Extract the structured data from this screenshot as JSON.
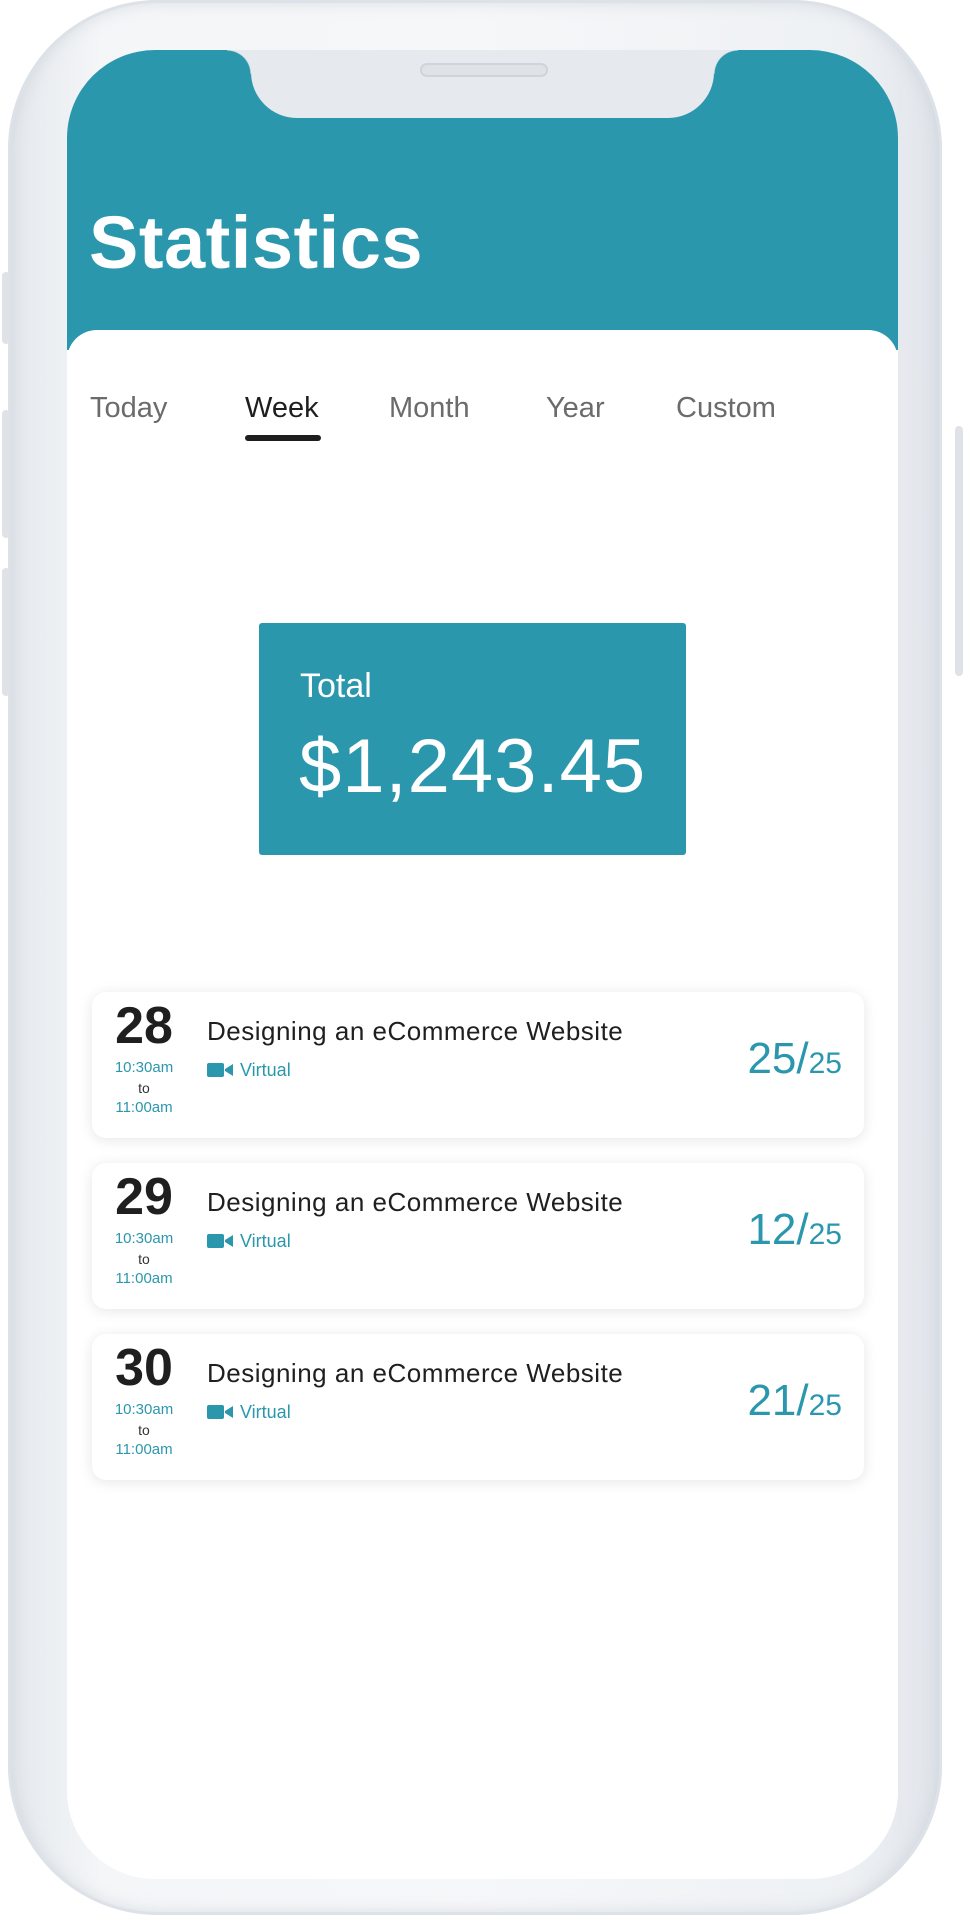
{
  "colors": {
    "accent": "#2b97ad",
    "text_dark": "#1f1f1f",
    "tab_inactive": "#6b6b6b"
  },
  "header": {
    "title": "Statistics"
  },
  "tabs": [
    {
      "label": "Today",
      "active": false
    },
    {
      "label": "Week",
      "active": true
    },
    {
      "label": "Month",
      "active": false
    },
    {
      "label": "Year",
      "active": false
    },
    {
      "label": "Custom",
      "active": false
    }
  ],
  "total": {
    "label": "Total",
    "value": "$1,243.45"
  },
  "events": [
    {
      "day": "28",
      "time_start": "10:30am",
      "time_sep": "to",
      "time_end": "11:00am",
      "title": "Designing an eCommerce Website",
      "mode": "Virtual",
      "mode_icon": "video-camera-icon",
      "count": "25",
      "separator": "/",
      "capacity": "25"
    },
    {
      "day": "29",
      "time_start": "10:30am",
      "time_sep": "to",
      "time_end": "11:00am",
      "title": "Designing an eCommerce Website",
      "mode": "Virtual",
      "mode_icon": "video-camera-icon",
      "count": "12",
      "separator": "/",
      "capacity": "25"
    },
    {
      "day": "30",
      "time_start": "10:30am",
      "time_sep": "to",
      "time_end": "11:00am",
      "title": "Designing an eCommerce Website",
      "mode": "Virtual",
      "mode_icon": "video-camera-icon",
      "count": "21",
      "separator": "/",
      "capacity": "25"
    }
  ]
}
